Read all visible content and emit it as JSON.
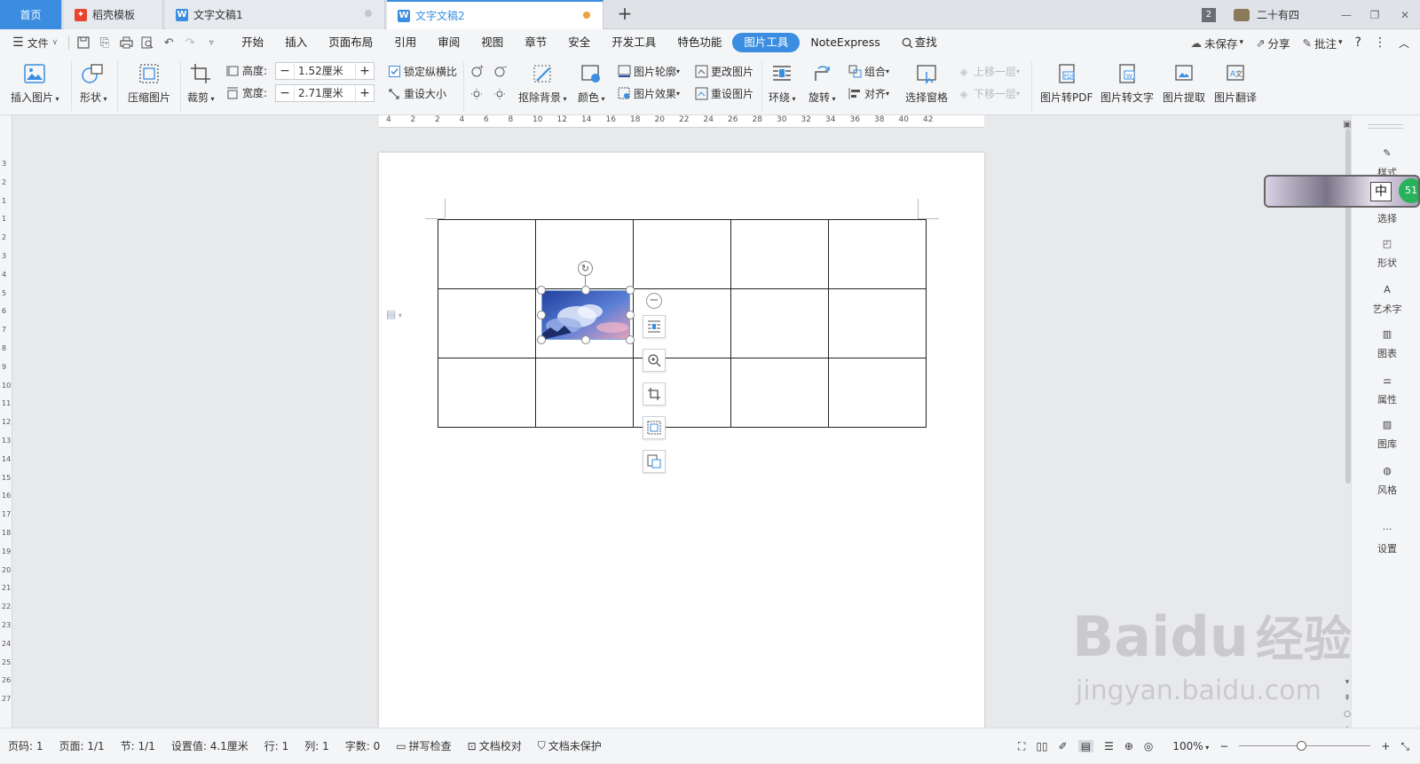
{
  "tabs": [
    {
      "label": "首页"
    },
    {
      "label": "稻壳模板"
    },
    {
      "label": "文字文稿1"
    },
    {
      "label": "文字文稿2"
    }
  ],
  "window": {
    "badge": "2",
    "user_name": "二十有四"
  },
  "menu": {
    "file_label": "文件",
    "items": [
      "开始",
      "插入",
      "页面布局",
      "引用",
      "审阅",
      "视图",
      "章节",
      "安全",
      "开发工具",
      "特色功能",
      "图片工具",
      "NoteExpress"
    ],
    "active_index": 10,
    "search_label": "查找",
    "right": {
      "save": "未保存",
      "share": "分享",
      "comment": "批注",
      "help": "?"
    }
  },
  "ribbon": {
    "insert_image": "插入图片",
    "shape": "形状",
    "compress": "压缩图片",
    "crop": "裁剪",
    "height_label": "高度:",
    "height_value": "1.52厘米",
    "width_label": "宽度:",
    "width_value": "2.71厘米",
    "lock_ratio": "锁定纵横比",
    "reset_size": "重设大小",
    "remove_bg": "抠除背景",
    "color": "颜色",
    "outline": "图片轮廓",
    "effect": "图片效果",
    "change_image": "更改图片",
    "reset_image": "重设图片",
    "wrap": "环绕",
    "rotate": "旋转",
    "group": "组合",
    "align": "对齐",
    "select_pane": "选择窗格",
    "bring_forward": "上移一层",
    "send_backward": "下移一层",
    "to_pdf": "图片转PDF",
    "to_text": "图片转文字",
    "extract": "图片提取",
    "translate": "图片翻译"
  },
  "ruler": {
    "h_ticks": [
      "4",
      "2",
      "2",
      "4",
      "6",
      "8",
      "10",
      "12",
      "14",
      "16",
      "18",
      "20",
      "22",
      "24",
      "26",
      "28",
      "30",
      "32",
      "34",
      "36",
      "38",
      "40",
      "42"
    ],
    "v_ticks": [
      "3",
      "2",
      "1",
      "1",
      "2",
      "3",
      "4",
      "5",
      "6",
      "7",
      "8",
      "9",
      "10",
      "11",
      "12",
      "13",
      "14",
      "15",
      "16",
      "17",
      "18",
      "19",
      "20",
      "21",
      "22",
      "23",
      "24",
      "25",
      "26",
      "27"
    ]
  },
  "right_panel": {
    "items": [
      "样式",
      "选择",
      "形状",
      "艺术字",
      "图表",
      "属性",
      "图库",
      "风格",
      "设置"
    ],
    "ime_label": "中",
    "badge": "51"
  },
  "status": {
    "page_code": "页码: 1",
    "page": "页面: 1/1",
    "section": "节: 1/1",
    "setting": "设置值: 4.1厘米",
    "row": "行: 1",
    "col": "列: 1",
    "words": "字数: 0",
    "spell": "拼写检查",
    "proof": "文档校对",
    "protect": "文档未保护",
    "zoom": "100%"
  },
  "watermark": {
    "brand": "Baidu",
    "cn": "经验",
    "url": "jingyan.baidu.com"
  },
  "colors": {
    "accent": "#3a8de0",
    "wps_red": "#e8452c",
    "word_blue": "#3a8de0"
  }
}
